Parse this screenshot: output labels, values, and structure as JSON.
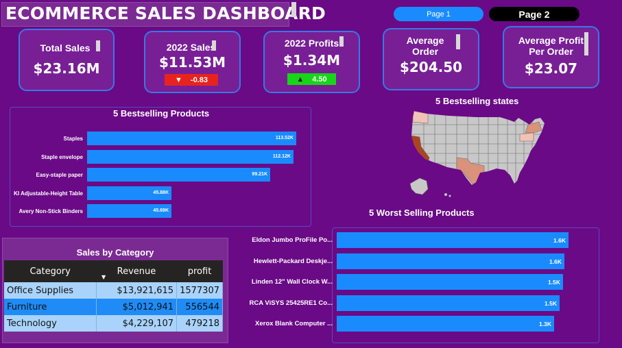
{
  "header": {
    "title": "ECOMMERCE SALES DASHBOARD",
    "nav": {
      "page1": "Page 1",
      "page2": "Page 2"
    }
  },
  "kpis": {
    "total_sales": {
      "label": "Total Sales",
      "value": "$23.16M"
    },
    "sales_2022": {
      "label": "2022 Sales",
      "value": "$11.53M",
      "delta": "-0.83",
      "delta_dir": "down"
    },
    "profits_2022": {
      "label": "2022 Profits",
      "value": "$1.34M",
      "delta": "4.50",
      "delta_dir": "up"
    },
    "avg_order": {
      "label_line1": "Average",
      "label_line2": "Order",
      "value": "$204.50"
    },
    "avg_profit": {
      "label_line1": "Average Profit",
      "label_line2": "Per Order",
      "value": "$23.07"
    }
  },
  "colors": {
    "background": "#6a0a86",
    "bar": "#1a8bff",
    "card_border": "#3a78e6",
    "delta_down": "#e8231f",
    "delta_up": "#17d617",
    "map_top_state": "#a9461f",
    "map_texas": "#d9937a"
  },
  "bestsellers": {
    "title": "5 Bestselling Products",
    "chart_data": {
      "type": "bar",
      "orientation": "horizontal",
      "categories": [
        "Staples",
        "Staple envelope",
        "Easy-staple paper",
        "KI Adjustable-Height Table",
        "Avery Non-Stick Binders"
      ],
      "values": [
        113.52,
        112.12,
        99.21,
        45.88,
        45.69
      ],
      "value_labels": [
        "113.52K",
        "112.12K",
        "99.21K",
        "45.88K",
        "45.69K"
      ]
    }
  },
  "states": {
    "title": "5 Bestselling states"
  },
  "worst": {
    "title": "5 Worst Selling Products",
    "chart_data": {
      "type": "bar",
      "orientation": "horizontal",
      "categories": [
        "Eldon Jumbo ProFile Po...",
        "Hewlett-Packard Deskje...",
        "Linden 12\" Wall Clock W...",
        "RCA ViSYS 25425RE1 Co...",
        "Xerox Blank Computer ..."
      ],
      "values": [
        1.6,
        1.6,
        1.5,
        1.5,
        1.3
      ],
      "value_labels": [
        "1.6K",
        "1.6K",
        "1.5K",
        "1.5K",
        "1.3K"
      ]
    }
  },
  "category": {
    "title": "Sales by Category",
    "columns": [
      "Category",
      "Revenue",
      "profit"
    ],
    "rows": [
      {
        "category": "Office Supplies",
        "revenue": "$13,921,615",
        "profit": "1577307"
      },
      {
        "category": "Furniture",
        "revenue": "$5,012,941",
        "profit": "556544"
      },
      {
        "category": "Technology",
        "revenue": "$4,229,107",
        "profit": "479218"
      }
    ]
  }
}
